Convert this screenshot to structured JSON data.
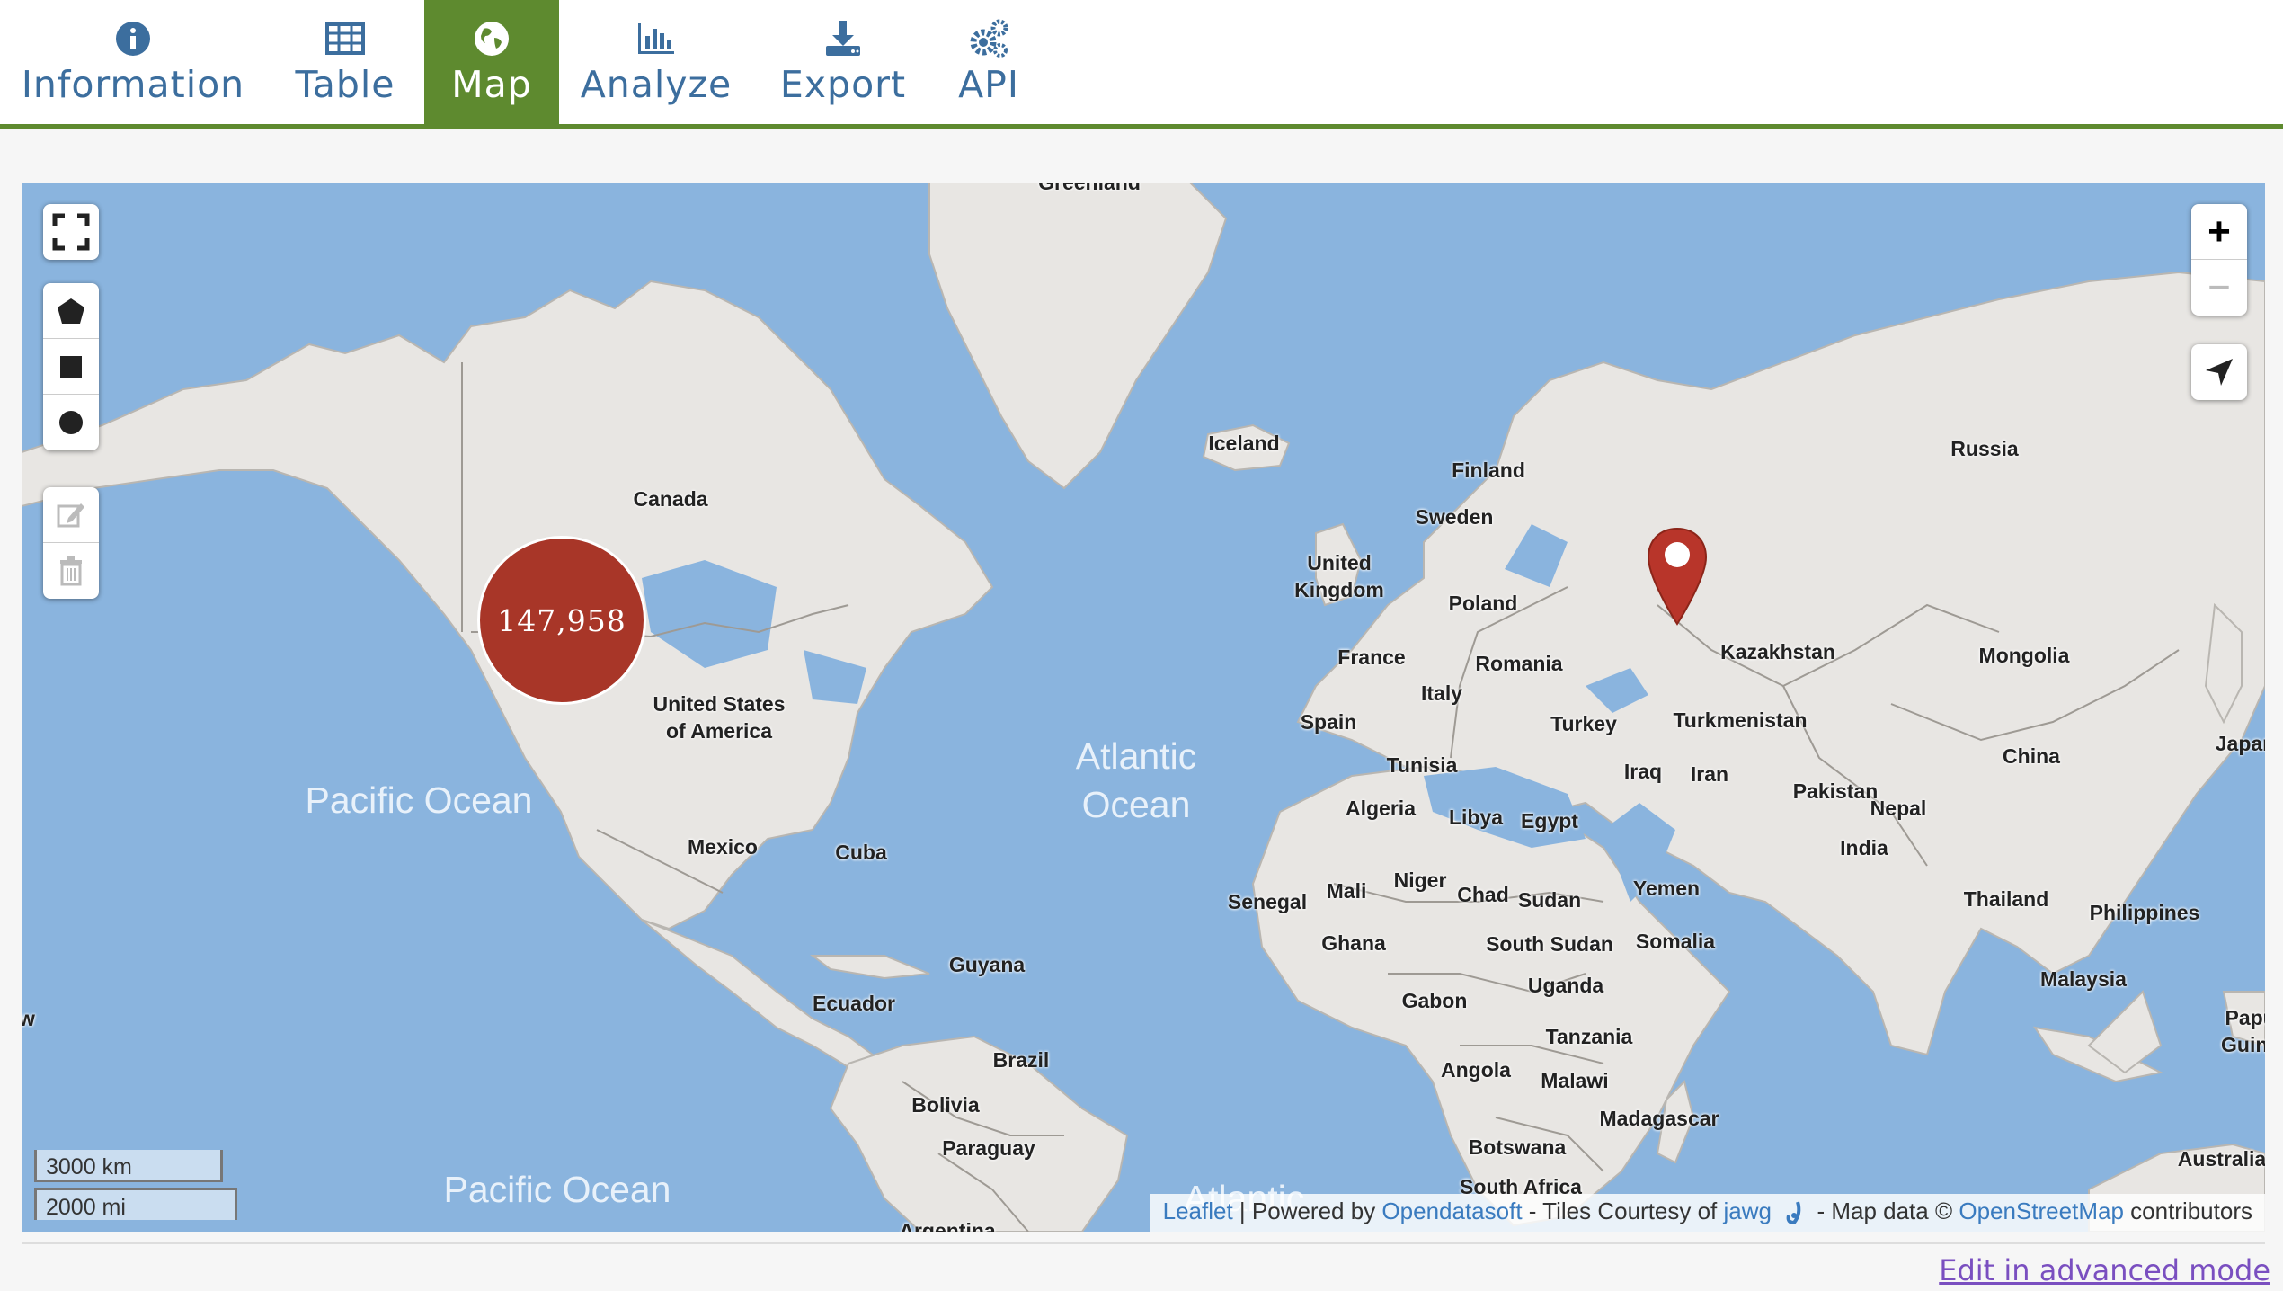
{
  "tabs": [
    {
      "label": "Information",
      "icon": "info-icon",
      "active": false
    },
    {
      "label": "Table",
      "icon": "table-icon",
      "active": false
    },
    {
      "label": "Map",
      "icon": "globe-icon",
      "active": true
    },
    {
      "label": "Analyze",
      "icon": "bar-chart-icon",
      "active": false
    },
    {
      "label": "Export",
      "icon": "download-icon",
      "active": false
    },
    {
      "label": "API",
      "icon": "gears-icon",
      "active": false
    }
  ],
  "map": {
    "cluster_count": "147,958",
    "zoom_in": "+",
    "zoom_out": "−",
    "countries": {
      "greenland": "Greenland",
      "canada": "Canada",
      "usa": "United States\nof America",
      "mexico": "Mexico",
      "cuba": "Cuba",
      "guyana": "Guyana",
      "ecuador": "Ecuador",
      "brazil": "Brazil",
      "bolivia": "Bolivia",
      "paraguay": "Paraguay",
      "argentina": "Argentina",
      "iceland": "Iceland",
      "uk": "United\nKingdom",
      "france": "France",
      "spain": "Spain",
      "italy": "Italy",
      "poland": "Poland",
      "romania": "Romania",
      "finland": "Finland",
      "sweden": "Sweden",
      "russia": "Russia",
      "kazakhstan": "Kazakhstan",
      "mongolia": "Mongolia",
      "china": "China",
      "japan": "Japan",
      "turkey": "Turkey",
      "turkmenistan": "Turkmenistan",
      "iraq": "Iraq",
      "iran": "Iran",
      "pakistan": "Pakistan",
      "nepal": "Nepal",
      "india": "India",
      "thailand": "Thailand",
      "philippines": "Philippines",
      "malaysia": "Malaysia",
      "papua": "Papua\nGuinea",
      "australia": "Australia",
      "tunisia": "Tunisia",
      "algeria": "Algeria",
      "libya": "Libya",
      "egypt": "Egypt",
      "senegal": "Senegal",
      "mali": "Mali",
      "niger": "Niger",
      "chad": "Chad",
      "sudan": "Sudan",
      "yemen": "Yemen",
      "ghana": "Ghana",
      "south_sudan": "South Sudan",
      "somalia": "Somalia",
      "gabon": "Gabon",
      "uganda": "Uganda",
      "tanzania": "Tanzania",
      "angola": "Angola",
      "malawi": "Malawi",
      "madagascar": "Madagascar",
      "botswana": "Botswana",
      "south_africa": "South Africa",
      "w": "w"
    },
    "oceans": {
      "pacific_north": "Pacific Ocean",
      "atlantic": "Atlantic\nOcean",
      "pacific_south": "Pacific Ocean",
      "atlantic_south": "Atlantic"
    },
    "scale": {
      "km": "3000 km",
      "mi": "2000 mi"
    },
    "attribution": {
      "leaflet": "Leaflet",
      "powered_by": " | Powered by ",
      "opendatasoft": "Opendatasoft",
      "tiles": " - Tiles Courtesy of ",
      "jawg": "jawg",
      "map_data": " - Map data © ",
      "osm": "OpenStreetMap",
      "contributors": " contributors"
    }
  },
  "advanced_mode_link": "Edit in advanced mode",
  "colors": {
    "accent": "#5e8a2f",
    "tab_text": "#3c6e9e",
    "water": "#8ab4de",
    "land": "#e8e6e3",
    "cluster": "#a83628",
    "link": "#7a4fc0"
  }
}
